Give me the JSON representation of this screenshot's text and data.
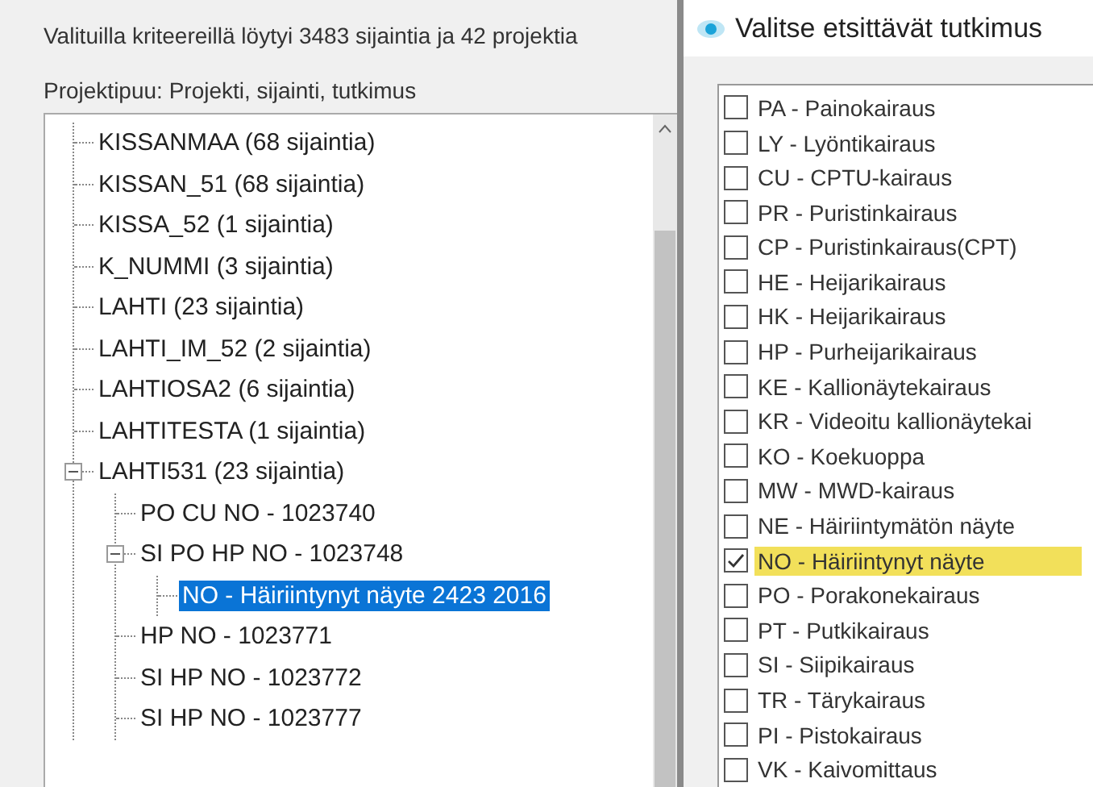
{
  "summary": "Valituilla kriteereillä löytyi 3483 sijaintia ja 42 projektia",
  "tree": {
    "label": "Projektipuu: Projekti, sijainti, tutkimus",
    "items": [
      {
        "label": "KISSANMAA (68 sijaintia)",
        "selected": false
      },
      {
        "label": "KISSAN_51 (68 sijaintia)",
        "selected": false
      },
      {
        "label": "KISSA_52 (1 sijaintia)",
        "selected": false
      },
      {
        "label": "K_NUMMI (3 sijaintia)",
        "selected": false
      },
      {
        "label": "LAHTI (23 sijaintia)",
        "selected": false
      },
      {
        "label": "LAHTI_IM_52 (2 sijaintia)",
        "selected": false
      },
      {
        "label": "LAHTIOSA2 (6 sijaintia)",
        "selected": false
      },
      {
        "label": "LAHTITESTA (1 sijaintia)",
        "selected": false
      },
      {
        "label": "LAHTI531 (23 sijaintia)",
        "selected": false,
        "expanded": true,
        "children": [
          {
            "label": "PO CU NO - 1023740",
            "selected": false
          },
          {
            "label": "SI PO HP NO - 1023748",
            "selected": false,
            "expanded": true,
            "children": [
              {
                "label": "NO - Häiriintynyt näyte 2423 2016",
                "selected": true
              }
            ]
          },
          {
            "label": "HP NO - 1023771",
            "selected": false
          },
          {
            "label": "SI HP NO - 1023772",
            "selected": false
          },
          {
            "label": "SI HP NO - 1023777",
            "selected": false
          }
        ]
      }
    ]
  },
  "dialog": {
    "title": "Valitse etsittävät tutkimus",
    "items": [
      {
        "label": "PA - Painokairaus",
        "checked": false,
        "highlighted": false
      },
      {
        "label": "LY - Lyöntikairaus",
        "checked": false,
        "highlighted": false
      },
      {
        "label": "CU - CPTU-kairaus",
        "checked": false,
        "highlighted": false
      },
      {
        "label": "PR - Puristinkairaus",
        "checked": false,
        "highlighted": false
      },
      {
        "label": "CP - Puristinkairaus(CPT)",
        "checked": false,
        "highlighted": false
      },
      {
        "label": "HE - Heijarikairaus",
        "checked": false,
        "highlighted": false
      },
      {
        "label": "HK - Heijarikairaus",
        "checked": false,
        "highlighted": false
      },
      {
        "label": "HP - Purheijarikairaus",
        "checked": false,
        "highlighted": false
      },
      {
        "label": "KE - Kallionäytekairaus",
        "checked": false,
        "highlighted": false
      },
      {
        "label": "KR - Videoitu kallionäytekai",
        "checked": false,
        "highlighted": false
      },
      {
        "label": "KO - Koekuoppa",
        "checked": false,
        "highlighted": false
      },
      {
        "label": "MW - MWD-kairaus",
        "checked": false,
        "highlighted": false
      },
      {
        "label": "NE - Häiriintymätön näyte",
        "checked": false,
        "highlighted": false
      },
      {
        "label": "NO - Häiriintynyt näyte",
        "checked": true,
        "highlighted": true
      },
      {
        "label": "PO - Porakonekairaus",
        "checked": false,
        "highlighted": false
      },
      {
        "label": "PT - Putkikairaus",
        "checked": false,
        "highlighted": false
      },
      {
        "label": "SI - Siipikairaus",
        "checked": false,
        "highlighted": false
      },
      {
        "label": "TR - Tärykairaus",
        "checked": false,
        "highlighted": false
      },
      {
        "label": "PI - Pistokairaus",
        "checked": false,
        "highlighted": false
      },
      {
        "label": "VK - Kaivomittaus",
        "checked": false,
        "highlighted": false
      }
    ]
  }
}
